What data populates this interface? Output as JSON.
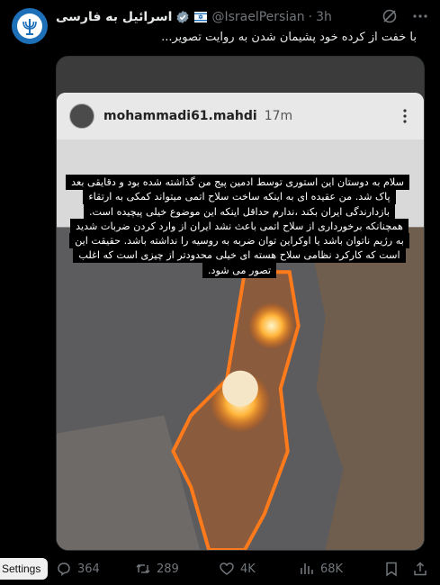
{
  "tweet": {
    "author_name": "اسرائیل به فارسی",
    "handle": "@IsraelPersian",
    "separator": "·",
    "time": "3h",
    "text": "با خفت از کرده خود پشیمان شدن به روایت تصویر..."
  },
  "story": {
    "username": "mohammadi61.mahdi",
    "time": "17m",
    "caption": "سلام به دوستان این استوری توسط ادمین پیج من گذاشته شده بود و دقایقی بعد پاک شد. من عقیده ای به اینکه ساخت سلاح اتمی میتواند کمکی به ارتقاء بازدارندگی ایران بکند ،ندارم حداقل اینکه این موضوع خیلی پیچیده است. همچنانکه برخورداری از سلاح اتمی باعث نشد ایران از وارد کردن ضربات شدید به رژیم ناتوان باشد یا اوکراین توان ضربه به روسیه را نداشته باشد. حقیقت این است که کارکرد نظامی سلاح هسته ای خیلی محدودتر از چیزی است که اغلب تصور می شود."
  },
  "actions": {
    "replies": "364",
    "reposts": "289",
    "likes": "4K",
    "views": "68K"
  },
  "overlay": {
    "settings_label": "Settings"
  },
  "icons": [
    "israel-emblem-icon",
    "verified-icon",
    "flag-icon",
    "grok-icon",
    "more-icon",
    "reply-icon",
    "repost-icon",
    "like-icon",
    "views-icon",
    "bookmark-icon",
    "share-icon"
  ],
  "colors": {
    "background": "#000000",
    "muted": "#71767b",
    "verified": "#829aab",
    "text": "#e7e9ea"
  }
}
